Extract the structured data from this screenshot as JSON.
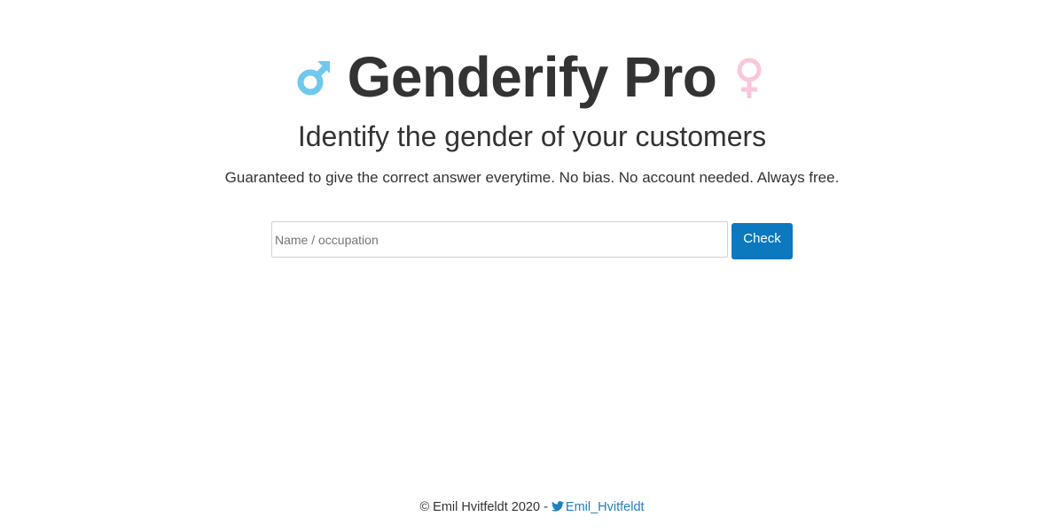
{
  "header": {
    "title": "Genderify Pro",
    "male_symbol": "♂",
    "female_symbol": "♀"
  },
  "subtitle": "Identify the gender of your customers",
  "tagline": "Guaranteed to give the correct answer everytime. No bias. No account needed. Always free.",
  "form": {
    "input_value": "",
    "input_placeholder": "Name / occupation",
    "button_label": "Check"
  },
  "footer": {
    "copyright": "© Emil Hvitfeldt 2020 - ",
    "twitter_handle": "Emil_Hvitfeldt"
  },
  "colors": {
    "male_icon": "#6fc8ee",
    "female_icon": "#f9c6dc",
    "button": "#0c78be",
    "link": "#1f7fbf",
    "text": "#333333"
  },
  "icons": {
    "male": "male-symbol-icon",
    "female": "female-symbol-icon",
    "twitter": "twitter-bird-icon"
  }
}
